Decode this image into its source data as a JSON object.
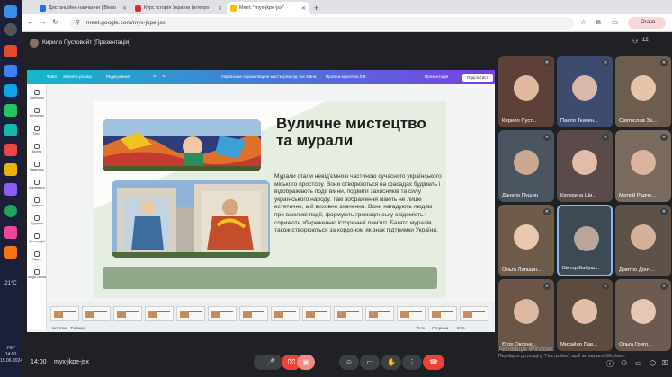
{
  "taskbar": {
    "weather": "21°C",
    "date": "15.06.2024",
    "lang": "УКР",
    "time": "14:00",
    "date_short": "15.06.2024"
  },
  "browser": {
    "tabs": [
      {
        "label": "Дистанційне навчання | Вікно",
        "active": false,
        "color": "#1a73e8"
      },
      {
        "label": "Курс Історія України (інтегро",
        "active": false,
        "color": "#d93025"
      },
      {
        "label": "Meet: \"myx-jkpe-jsx\"",
        "active": true,
        "color": "#fbbc04"
      }
    ],
    "url": "meet.google.com/myx-jkpe-jsx",
    "profile_label": "Огаєв"
  },
  "meet": {
    "presenter": "Кирило Пустовойт (Презентація)",
    "people_count": "12",
    "clock": "14:00",
    "meeting_code": "myx-jkpe-jsx"
  },
  "canva": {
    "top_labels": {
      "file": "Файл",
      "resize": "Змінити розмір",
      "edit": "Редагування",
      "title": "Українське образотворче мистецтво під час війни",
      "trial": "Пробна версія за 0 ₴",
      "present": "Презентація",
      "share": "Поділитися"
    },
    "side_items": [
      "Шаблони",
      "Елементи",
      "Текст",
      "Бренд",
      "Завантаж.",
      "Малювати",
      "Проєкти",
      "Додатки",
      "Фотографії",
      "Відео",
      "Magic Media"
    ],
    "slide": {
      "title": "Вуличне мистецтво та мурали",
      "body": "Мурали стали невід'ємною частиною сучасного українського міського простору. Вони створюються на фасадах будівель і відображають події війни, подвиги захисників та силу українського народу. Такі зображення мають не лише естетичне, а й виховне значення. Вони нагадують людям про важливі події, формують громадянську свідомість і сприяють збереженню історичної пам'яті. Багато муралів також створюються за кордоном як знак підтримки України."
    },
    "bottom": {
      "notes": "Нотатки",
      "timer": "Таймер",
      "zoom": "75 %",
      "pages": "Сторінки",
      "page_num": "8/16"
    }
  },
  "participants": [
    {
      "name": "Кирило Пуст...",
      "bg": "#5d4037",
      "face": "#e0b9a0",
      "muted": true
    },
    {
      "name": "Павло Ткачен...",
      "bg": "#3c4b6e",
      "face": "#d8b8a8",
      "muted": true
    },
    {
      "name": "Святослав За...",
      "bg": "#6d5d4f",
      "face": "#e5c4a8",
      "muted": true
    },
    {
      "name": "Данило Пушин",
      "bg": "#4a5561",
      "face": "#caa990",
      "muted": true
    },
    {
      "name": "Катерина Ши...",
      "bg": "#5a4a4a",
      "face": "#e2bca8",
      "muted": true
    },
    {
      "name": "Матвій Радче...",
      "bg": "#7a6a5d",
      "face": "#d9b5a0",
      "muted": true
    },
    {
      "name": "Ольга Лапшин...",
      "bg": "#6e5b4a",
      "face": "#e8c8b0",
      "muted": true
    },
    {
      "name": "Віктор Бабуш...",
      "bg": "#3b4a55",
      "face": "#b9a59a",
      "muted": false
    },
    {
      "name": "Дмитро Донч...",
      "bg": "#5d5148",
      "face": "#d4b19a",
      "muted": true
    },
    {
      "name": "Єгор Оксене...",
      "bg": "#6a5548",
      "face": "#dcb9a0",
      "muted": true
    },
    {
      "name": "Михайло Пав...",
      "bg": "#5c4b3f",
      "face": "#e0bfa8",
      "muted": true
    },
    {
      "name": "Ольга Григо...",
      "bg": "#6d5b52",
      "face": "#e6c6b5",
      "muted": true
    }
  ],
  "watermark": {
    "line1": "Активація Windows",
    "line2": "Перейдіть до розділу \"Настройки\", щоб активувати Windows."
  },
  "icons": {
    "more": "more-vert-icon",
    "mic": "mic-icon",
    "cam": "camera-off-icon",
    "emoji": "emoji-icon",
    "present": "present-icon",
    "hand": "raise-hand-icon",
    "more2": "more-vert-icon",
    "end": "call-end-icon"
  }
}
